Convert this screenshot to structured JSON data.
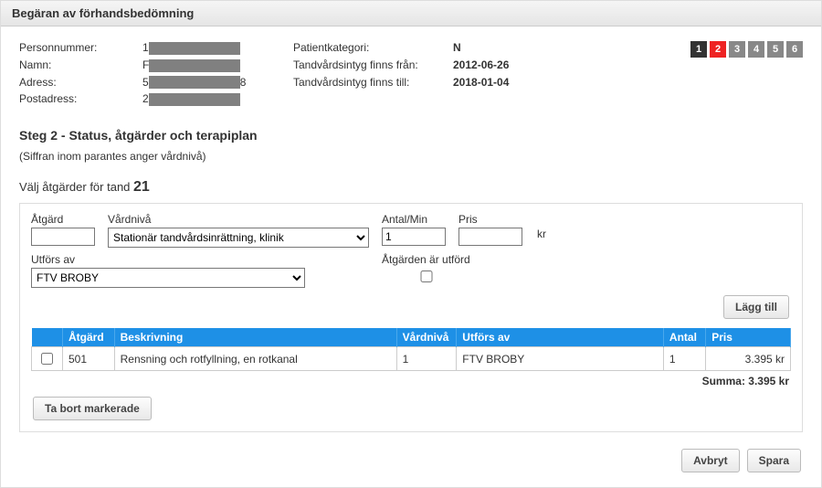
{
  "header": {
    "title": "Begäran av förhandsbedömning"
  },
  "patient": {
    "labels": {
      "personnummer": "Personnummer:",
      "namn": "Namn:",
      "adress": "Adress:",
      "postadress": "Postadress:",
      "patientkategori": "Patientkategori:",
      "intyg_fran": "Tandvårdsintyg finns från:",
      "intyg_till": "Tandvårdsintyg finns till:"
    },
    "values": {
      "personnummer_prefix": "1",
      "namn_prefix": "F",
      "adress_prefix": "5",
      "adress_suffix": "8",
      "postadress_prefix": "2",
      "patientkategori": "N",
      "intyg_fran": "2012-06-26",
      "intyg_till": "2018-01-04"
    }
  },
  "steps": {
    "title": "Steg 2 - Status, åtgärder och terapiplan",
    "sub": "(Siffran inom parantes anger vårdnivå)",
    "items": [
      "1",
      "2",
      "3",
      "4",
      "5",
      "6"
    ],
    "active": "2"
  },
  "choose": {
    "prefix": "Välj åtgärder för tand ",
    "tooth": "21"
  },
  "form": {
    "labels": {
      "atgard": "Åtgärd",
      "vardniva": "Vårdnivå",
      "antal": "Antal/Min",
      "pris": "Pris",
      "kr": "kr",
      "utfors": "Utförs av",
      "utford": "Åtgärden är utförd"
    },
    "values": {
      "atgard": "",
      "vardniva": "Stationär tandvårdsinrättning, klinik",
      "antal": "1",
      "pris": "",
      "utfors": "FTV BROBY",
      "utford_checked": false
    }
  },
  "buttons": {
    "lagg_till": "Lägg till",
    "ta_bort": "Ta bort markerade",
    "avbryt": "Avbryt",
    "spara": "Spara"
  },
  "table": {
    "headers": {
      "check": "",
      "atgard": "Åtgärd",
      "beskrivning": "Beskrivning",
      "vardniva": "Vårdnivå",
      "utfors": "Utförs av",
      "antal": "Antal",
      "pris": "Pris"
    },
    "rows": [
      {
        "atgard": "501",
        "beskrivning": "Rensning och rotfyllning, en rotkanal",
        "vardniva": "1",
        "utfors": "FTV BROBY",
        "antal": "1",
        "pris": "3.395 kr"
      }
    ],
    "summa_label": "Summa:",
    "summa_value": "3.395 kr"
  }
}
